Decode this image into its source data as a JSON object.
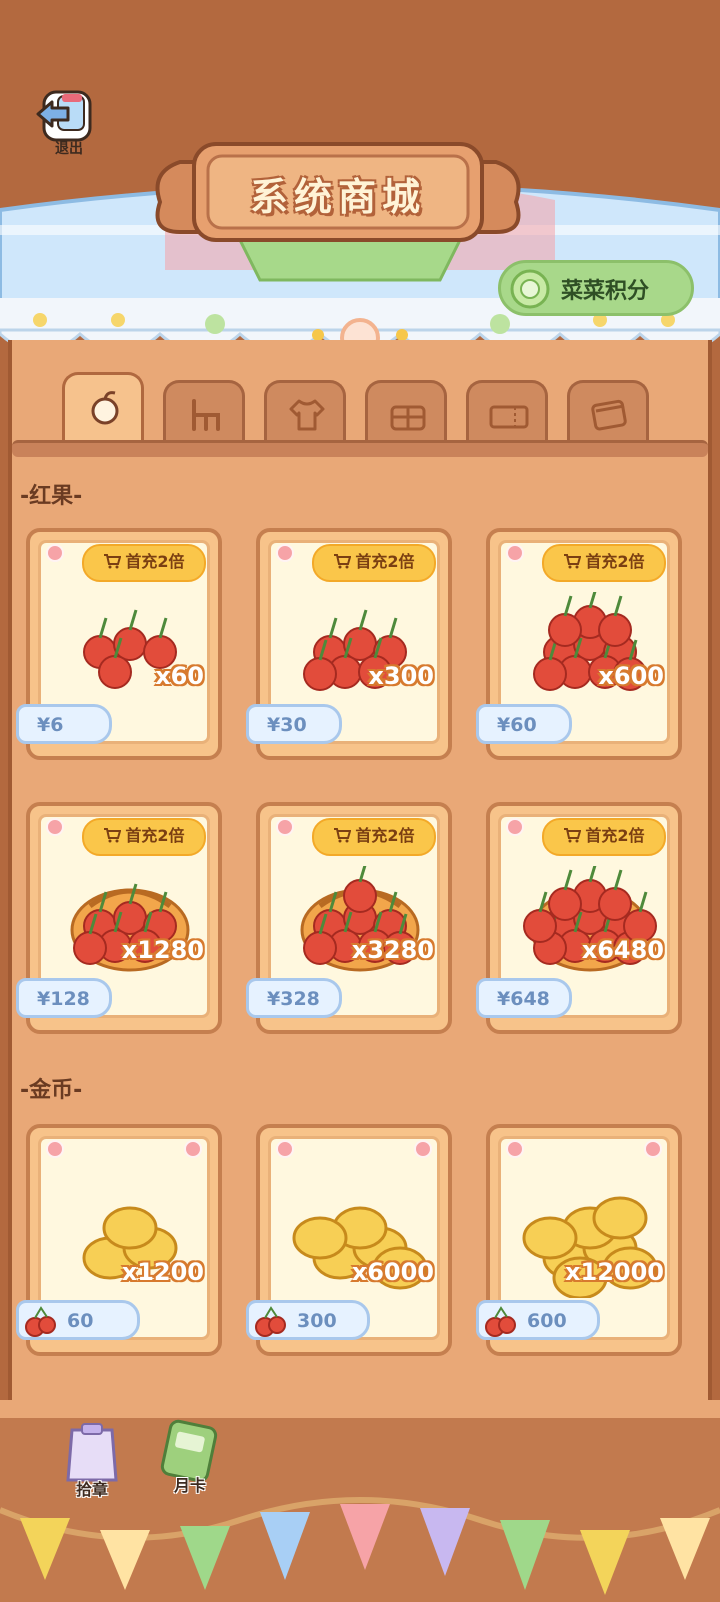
{
  "header": {
    "exit_label": "退出",
    "title": "系统商城",
    "points_label": "菜菜积分"
  },
  "tabs": [
    {
      "icon": "fruit-icon",
      "active": true
    },
    {
      "icon": "chair-icon",
      "active": false
    },
    {
      "icon": "shirt-icon",
      "active": false
    },
    {
      "icon": "gift-icon",
      "active": false
    },
    {
      "icon": "ticket-icon",
      "active": false
    },
    {
      "icon": "card-icon",
      "active": false
    }
  ],
  "sections": {
    "red_fruit": {
      "title": "-红果-",
      "items": [
        {
          "badge": "首充2倍",
          "qty": "x60",
          "price": "¥6"
        },
        {
          "badge": "首充2倍",
          "qty": "x300",
          "price": "¥30"
        },
        {
          "badge": "首充2倍",
          "qty": "x600",
          "price": "¥60"
        },
        {
          "badge": "首充2倍",
          "qty": "x1280",
          "price": "¥128"
        },
        {
          "badge": "首充2倍",
          "qty": "x3280",
          "price": "¥328"
        },
        {
          "badge": "首充2倍",
          "qty": "x6480",
          "price": "¥648"
        }
      ]
    },
    "coins": {
      "title": "-金币-",
      "items": [
        {
          "qty": "x1200",
          "price": "60"
        },
        {
          "qty": "x6000",
          "price": "300"
        },
        {
          "qty": "x12000",
          "price": "600"
        }
      ]
    }
  },
  "bottom": {
    "stamp_label": "拾章",
    "monthly_label": "月卡"
  },
  "colors": {
    "background": "#b3693f",
    "badge": "#fac64a",
    "price_tag": "#e6f2ff"
  }
}
